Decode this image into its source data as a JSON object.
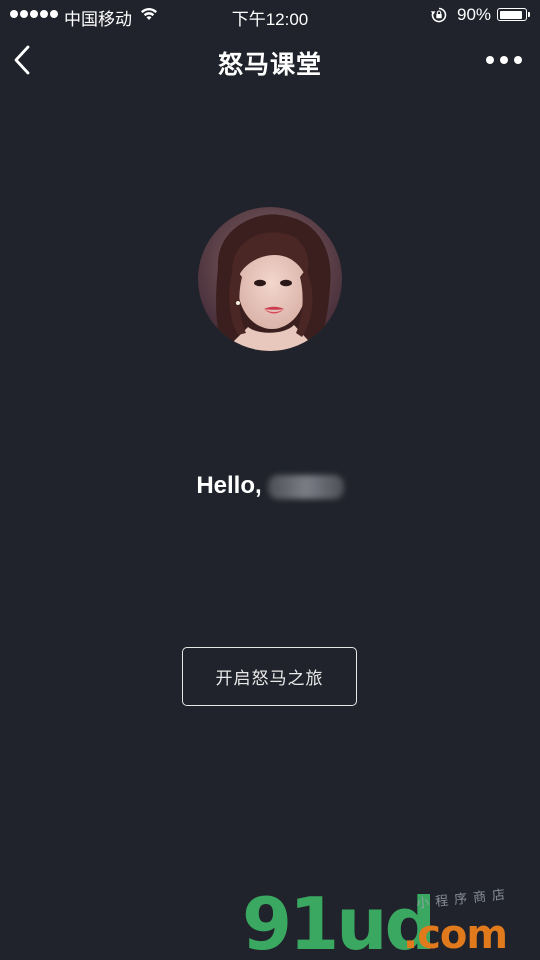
{
  "status_bar": {
    "carrier": "中国移动",
    "time": "下午12:00",
    "battery": "90%",
    "battery_level_percent": 90
  },
  "nav": {
    "title": "怒马课堂",
    "back_icon": "chevron-left-icon",
    "more_icon": "more-dots-icon"
  },
  "profile": {
    "greeting": "Hello,"
  },
  "actions": {
    "start_label": "开启怒马之旅"
  },
  "watermark": {
    "main": "91ud",
    "suffix": ".com",
    "sub": "小程序商店"
  },
  "colors": {
    "background": "#20232b",
    "text": "#ffffff",
    "watermark_green": "#3aa860",
    "watermark_orange": "#e07a1c"
  }
}
